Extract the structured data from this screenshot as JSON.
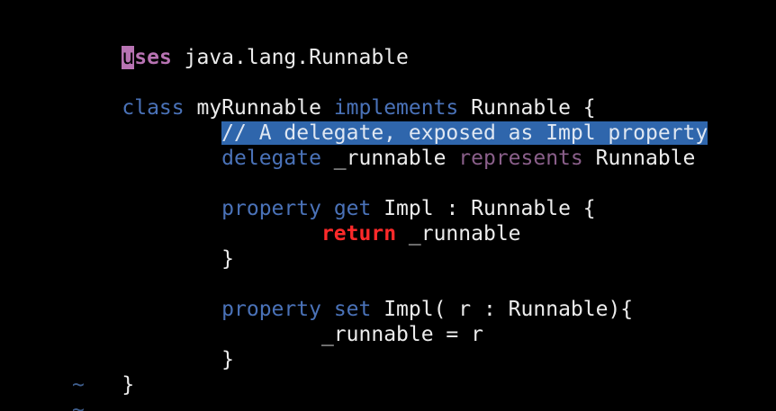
{
  "colors": {
    "background": "#000000",
    "keyword_blue": "#4a72b8",
    "keyword_purple": "#b873b3",
    "keyword_muted_purple": "#8a5f8a",
    "return_red": "#ff2a2a",
    "plain_text": "#ececec",
    "selection_bg": "#2f66ac",
    "tilde": "#3f5f8f"
  },
  "lines": [
    {
      "cursor_char": "u",
      "uses_rest": "ses",
      "import_path": " java.lang.Runnable"
    },
    {},
    {
      "class_kw": "class",
      "class_name": " myRunnable ",
      "implements_kw": "implements",
      "interface": " Runnable {"
    },
    {
      "indent": "        ",
      "comment": "// A delegate, exposed as Impl property"
    },
    {
      "indent": "        ",
      "delegate_kw": "delegate",
      "field": " _runnable ",
      "represents_kw": "represents",
      "type": " Runnable"
    },
    {},
    {
      "indent": "        ",
      "property_kw": "property",
      "space": " ",
      "get_kw": "get",
      "signature": " Impl : Runnable {"
    },
    {
      "indent": "                ",
      "return_kw": "return",
      "value": " _runnable"
    },
    {
      "indent": "        ",
      "brace": "}"
    },
    {},
    {
      "indent": "        ",
      "property_kw": "property",
      "space": " ",
      "set_kw": "set",
      "signature": " Impl( r : Runnable){"
    },
    {
      "indent": "                ",
      "assignment": "_runnable = r"
    },
    {
      "indent": "        ",
      "brace": "}"
    },
    {
      "brace": "}"
    }
  ],
  "empty_line_marker": "~"
}
